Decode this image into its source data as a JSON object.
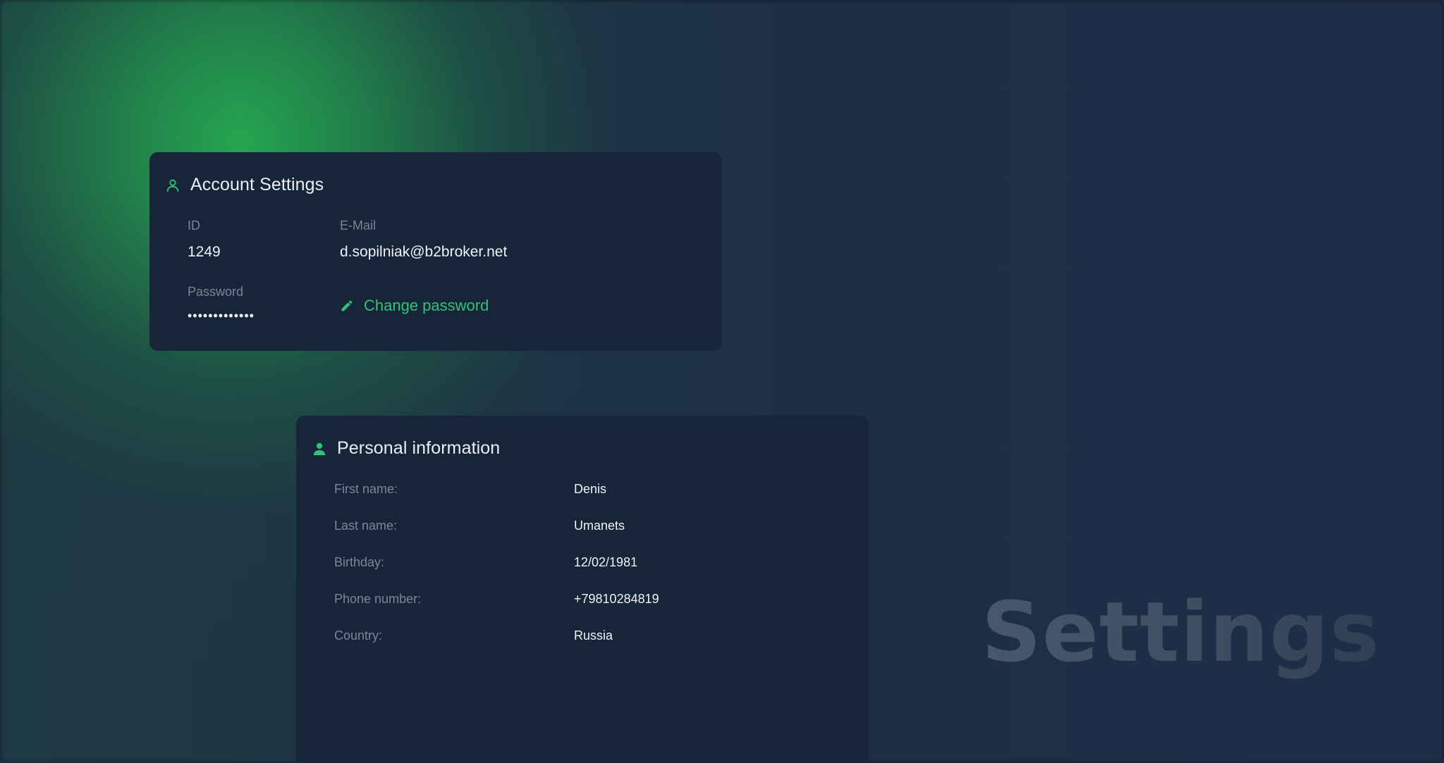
{
  "colors": {
    "accent": "#2fc27a",
    "card_bg": "#172539",
    "page_bg": "#1d2d44",
    "label": "#7b8698",
    "value": "#eef2f7"
  },
  "account": {
    "title": "Account Settings",
    "icon": "user-outline-icon",
    "id_label": "ID",
    "id_value": "1249",
    "email_label": "E-Mail",
    "email_value": "d.sopilniak@b2broker.net",
    "password_label": "Password",
    "password_value": "•••••••••••••",
    "change_password_label": "Change password",
    "change_password_icon": "pencil-icon"
  },
  "personal": {
    "title": "Personal information",
    "icon": "user-filled-icon",
    "rows": [
      {
        "label": "First name:",
        "value": "Denis"
      },
      {
        "label": "Last name:",
        "value": "Umanets"
      },
      {
        "label": "Birthday:",
        "value": "12/02/1981"
      },
      {
        "label": "Phone number:",
        "value": "+79810284819"
      },
      {
        "label": "Country:",
        "value": "Russia"
      }
    ]
  },
  "watermark": "Settings"
}
